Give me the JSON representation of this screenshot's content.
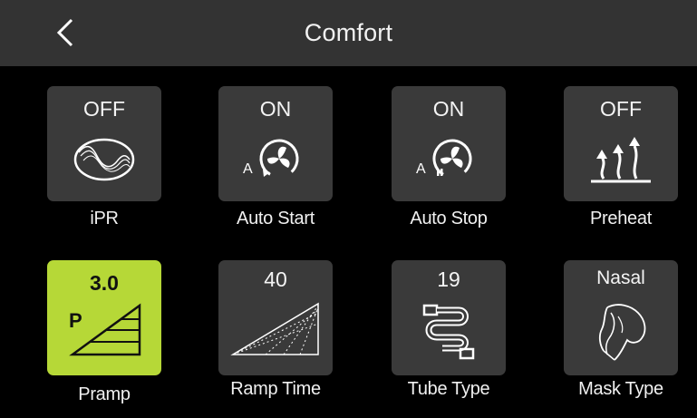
{
  "header": {
    "title": "Comfort",
    "back_icon": "chevron-left-icon"
  },
  "settings": [
    {
      "label": "iPR",
      "value": "OFF",
      "icon": "ipr-icon",
      "active": false
    },
    {
      "label": "Auto Start",
      "value": "ON",
      "icon": "auto-start-icon",
      "active": false
    },
    {
      "label": "Auto Stop",
      "value": "ON",
      "icon": "auto-stop-icon",
      "active": false
    },
    {
      "label": "Preheat",
      "value": "OFF",
      "icon": "preheat-icon",
      "active": false
    },
    {
      "label": "Pramp",
      "value": "3.0",
      "icon": "pramp-icon",
      "icon_text": "P",
      "active": true
    },
    {
      "label": "Ramp Time",
      "value": "40",
      "icon": "ramp-time-icon",
      "active": false
    },
    {
      "label": "Tube Type",
      "value": "19",
      "icon": "tube-type-icon",
      "active": false
    },
    {
      "label": "Mask Type",
      "value": "Nasal",
      "icon": "mask-type-icon",
      "active": false
    }
  ],
  "auto_icon_letter": "A",
  "colors": {
    "header_bg": "#333333",
    "tile_bg": "#3a3a3a",
    "active_bg": "#b6d837",
    "background": "#000000"
  }
}
